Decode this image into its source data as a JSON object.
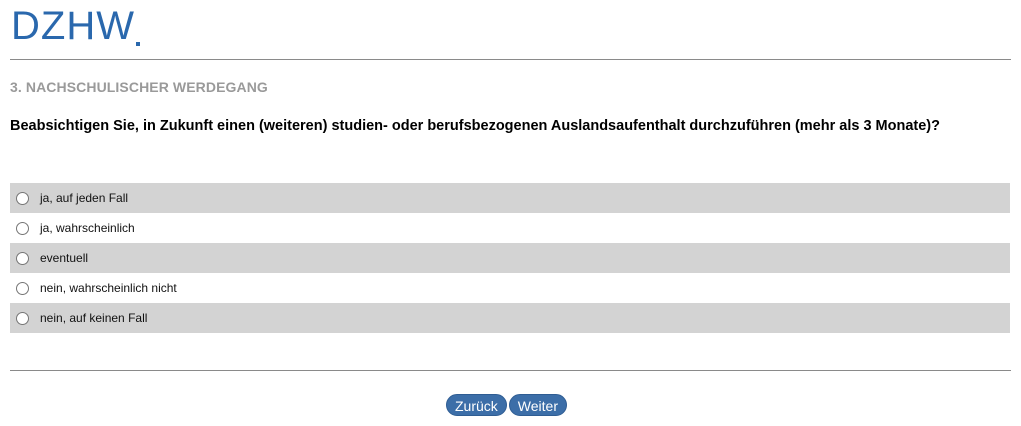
{
  "logo": {
    "text": "DZHW"
  },
  "section": {
    "title": "3. NACHSCHULISCHER WERDEGANG"
  },
  "question": {
    "text": "Beabsichtigen Sie, in Zukunft einen (weiteren) studien- oder berufsbezogenen Auslandsaufenthalt durchzuführen (mehr als 3 Monate)?"
  },
  "options": [
    {
      "label": "ja, auf jeden Fall",
      "selected": false
    },
    {
      "label": "ja, wahrscheinlich",
      "selected": false
    },
    {
      "label": "eventuell",
      "selected": false
    },
    {
      "label": "nein, wahrscheinlich nicht",
      "selected": false
    },
    {
      "label": "nein, auf keinen Fall",
      "selected": false
    }
  ],
  "nav": {
    "back_label": "Zurück",
    "next_label": "Weiter"
  },
  "colors": {
    "brand": "#2a68ad",
    "button": "#3c6ea8",
    "row_shade": "#d3d3d3",
    "section_title": "#9a9a9a"
  }
}
